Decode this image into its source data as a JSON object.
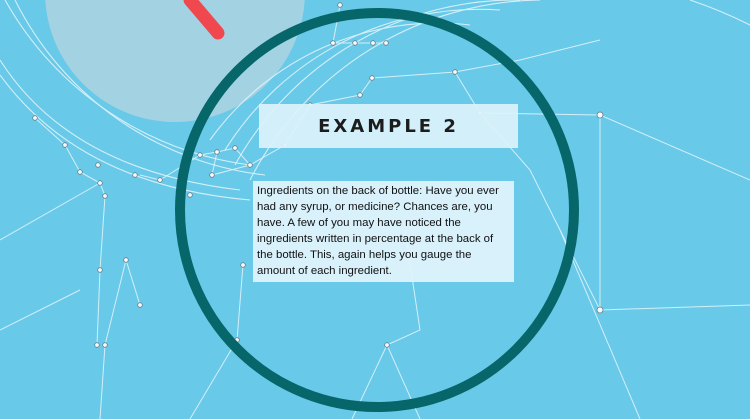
{
  "slide": {
    "title": "EXAMPLE 2",
    "body": "Ingredients on the back of bottle: Have you ever had any syrup, or medicine? Chances are, you have. A few of you may have noticed the ingredients written in percentage at the back of the bottle. This, again helps you gauge the amount of each ingredient."
  },
  "colors": {
    "background": "#68c9e8",
    "ring": "#07666a",
    "accent": "#f0484f",
    "node-lines": "#e6f6fb"
  }
}
